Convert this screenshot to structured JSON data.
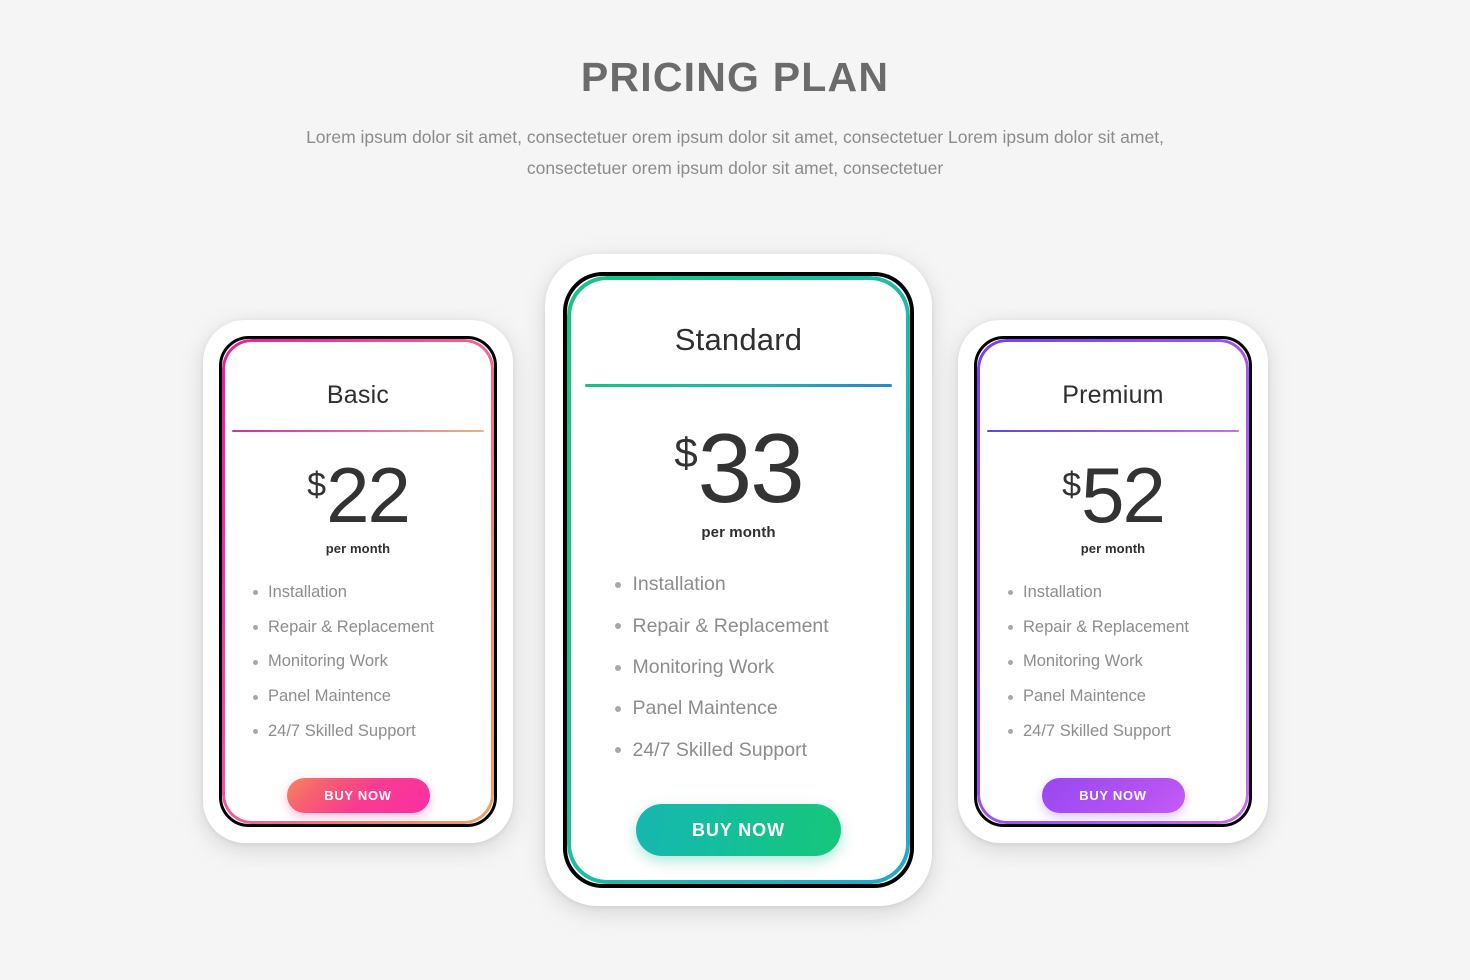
{
  "header": {
    "title": "PRICING PLAN",
    "subtitle": "Lorem ipsum dolor sit amet, consectetuer orem ipsum dolor sit amet, consectetuer Lorem ipsum dolor sit amet, consectetuer orem ipsum dolor sit amet, consectetuer"
  },
  "plans": [
    {
      "name": "Basic",
      "currency": "$",
      "amount": "22",
      "period": "per month",
      "features": [
        "Installation",
        "Repair & Replacement",
        "Monitoring Work",
        "Panel Maintence",
        "24/7 Skilled Support"
      ],
      "cta": "BUY NOW",
      "accent_start": "#e41f9b",
      "accent_end": "#f0a05f",
      "button_start": "#f5885f",
      "button_end": "#fb2fa3",
      "featured": false
    },
    {
      "name": "Standard",
      "currency": "$",
      "amount": "33",
      "period": "per month",
      "features": [
        "Installation",
        "Repair & Replacement",
        "Monitoring Work",
        "Panel Maintence",
        "24/7 Skilled Support"
      ],
      "cta": "BUY NOW",
      "accent_start": "#14c386",
      "accent_end": "#22a8c8",
      "button_start": "#16b7b0",
      "button_end": "#16c77c",
      "featured": true
    },
    {
      "name": "Premium",
      "currency": "$",
      "amount": "52",
      "period": "per month",
      "features": [
        "Installation",
        "Repair & Replacement",
        "Monitoring Work",
        "Panel Maintence",
        "24/7 Skilled Support"
      ],
      "cta": "BUY NOW",
      "accent_start": "#7a3df3",
      "accent_end": "#c86dec",
      "button_start": "#9a46f3",
      "button_end": "#c45df4",
      "featured": false
    }
  ],
  "theme": {
    "background": "#f5f5f5",
    "title_color": "#6b6b6b",
    "subtitle_color": "#8b8b8b",
    "price_color": "#333333",
    "feature_color": "#8d8d8d"
  }
}
